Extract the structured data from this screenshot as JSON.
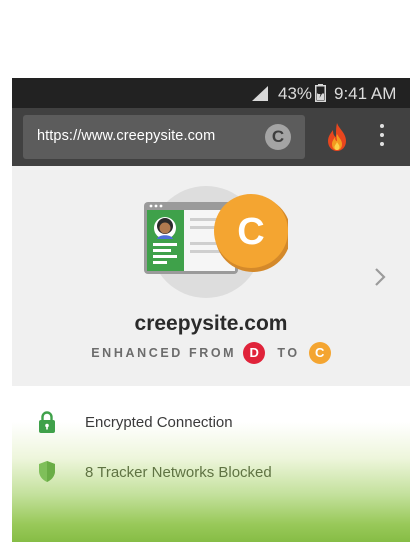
{
  "status_bar": {
    "battery_percent": "43%",
    "time": "9:41 AM",
    "icons": [
      "signal-icon",
      "battery-icon"
    ]
  },
  "toolbar": {
    "url": "https://www.creepysite.com",
    "url_grade": "C",
    "icons": [
      "flame-icon",
      "overflow-menu-icon"
    ]
  },
  "privacy_panel": {
    "domain": "creepysite.com",
    "enhanced_label_prefix": "ENHANCED FROM",
    "enhanced_label_joiner": "TO",
    "grade_from": "D",
    "grade_to": "C",
    "illustration_grade": "C",
    "colors": {
      "grade_d": "#e0233a",
      "grade_c": "#f4a531",
      "green": "#86bd45"
    }
  },
  "details": {
    "encrypted_label": "Encrypted Connection",
    "trackers_label": "8 Tracker Networks Blocked"
  }
}
